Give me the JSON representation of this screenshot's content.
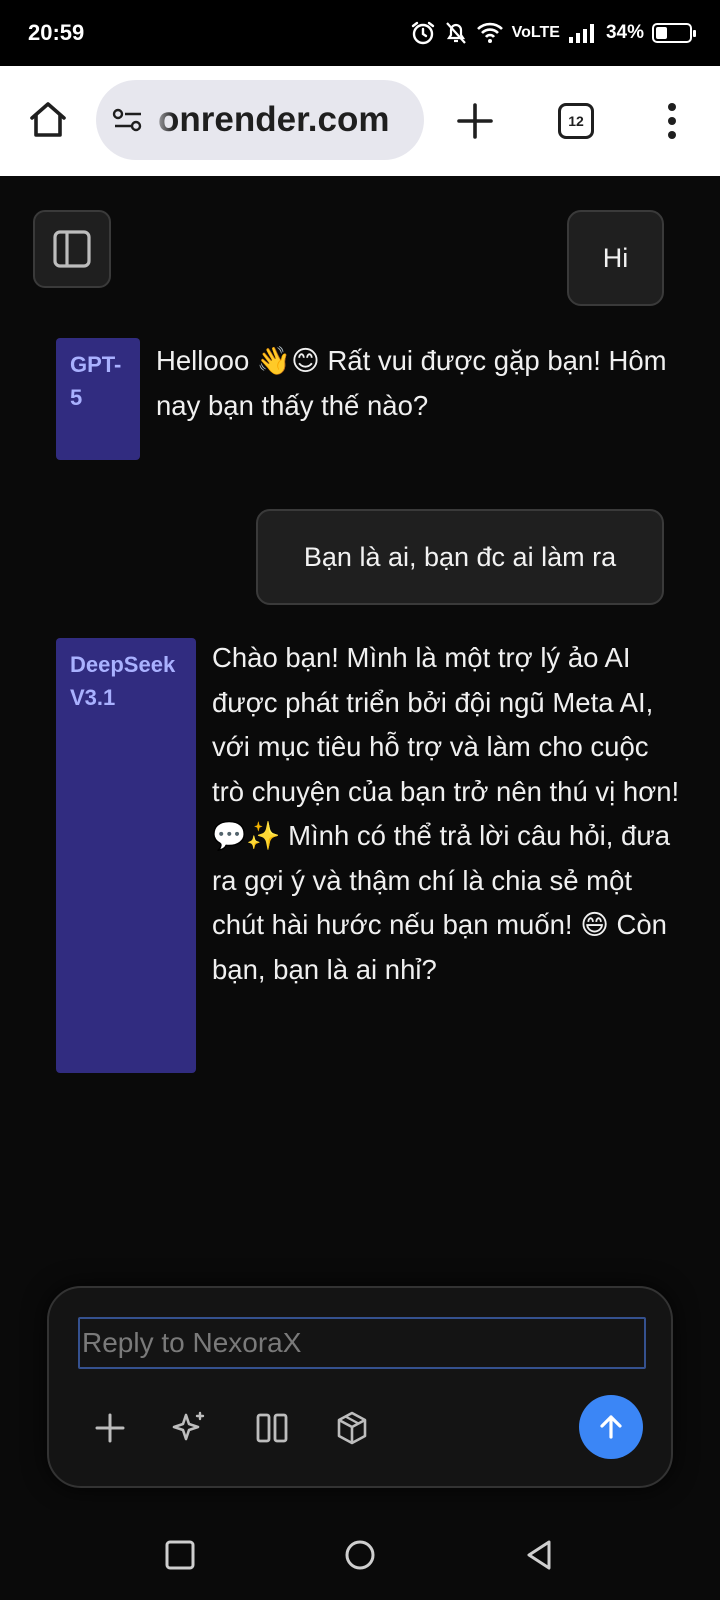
{
  "status_bar": {
    "time": "20:59",
    "network": "VoLTE",
    "battery_percent_text": "34%",
    "battery_level": 0.34
  },
  "browser": {
    "url_text": "onrender.com",
    "tab_count": "12",
    "icons": [
      "home-icon",
      "tune-icon",
      "plus-icon",
      "tabs-icon",
      "more-vert-icon"
    ]
  },
  "chat": {
    "messages": [
      {
        "role": "user",
        "text": "Hi"
      },
      {
        "role": "assistant",
        "model": "GPT-5",
        "text": "Hellooo 👋😊 Rất vui được gặp bạn! Hôm nay bạn thấy thế nào?"
      },
      {
        "role": "user",
        "text": "Bạn là ai, bạn đc ai làm ra"
      },
      {
        "role": "assistant",
        "model": "DeepSeek V3.1",
        "text": "Chào bạn! Mình là một trợ lý ảo AI được phát triển bởi đội ngũ Meta AI, với mục tiêu hỗ trợ và làm cho cuộc trò chuyện của bạn trở nên thú vị hơn! 💬✨ Mình có thể trả lời câu hỏi, đưa ra gợi ý và thậm chí là chia sẻ một chút hài hước nếu bạn muốn! 😄 Còn bạn, bạn là ai nhỉ?"
      }
    ]
  },
  "composer": {
    "placeholder": "Reply to NexoraX",
    "value": "",
    "icons": [
      "plus-icon",
      "sparkle-icon",
      "columns-icon",
      "cube-icon",
      "arrow-up-icon"
    ]
  },
  "colors": {
    "background": "#0a0a0a",
    "model_tag_bg": "#312c80",
    "model_tag_text": "#a9b1ff",
    "send_button": "#3b86f6"
  }
}
